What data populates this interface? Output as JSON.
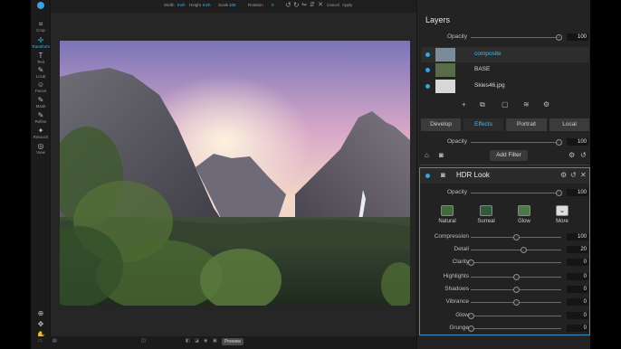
{
  "colors": {
    "accent": "#4fb7e8",
    "panel": "#232323",
    "frame": "#3d8fc4"
  },
  "tools": [
    {
      "icon": "crop-icon",
      "label": "Crop"
    },
    {
      "icon": "transform-icon",
      "label": "Transform"
    },
    {
      "icon": "text-icon",
      "label": "Text"
    },
    {
      "icon": "local-icon",
      "label": "Local"
    },
    {
      "icon": "faces-icon",
      "label": "Faces"
    },
    {
      "icon": "mask-icon",
      "label": "Mask"
    },
    {
      "icon": "refine-icon",
      "label": "Refine"
    },
    {
      "icon": "retouch-icon",
      "label": "Retouch"
    },
    {
      "icon": "view-icon",
      "label": "View"
    }
  ],
  "topbar": {
    "width_label": "Width",
    "width_value": "Inch",
    "height_label": "Height",
    "height_value": "Inch",
    "scale_label": "Scale",
    "scale_value": "100",
    "rotation_label": "Rotation",
    "rotation_value": "0",
    "cancel_label": "Cancel",
    "apply_label": "Apply"
  },
  "bottombar": {
    "preview_label": "Preview"
  },
  "layers": {
    "title": "Layers",
    "opacity_label": "Opacity",
    "opacity_value": "100",
    "items": [
      {
        "name": "composite",
        "active": true
      },
      {
        "name": "BASE",
        "active": false
      },
      {
        "name": "Skies46.jpg",
        "active": false
      }
    ]
  },
  "tabs": [
    {
      "label": "Develop",
      "active": false
    },
    {
      "label": "Effects",
      "active": true
    },
    {
      "label": "Portrait",
      "active": false
    },
    {
      "label": "Local",
      "active": false
    }
  ],
  "effects": {
    "opacity_label": "Opacity",
    "opacity_value": "100",
    "add_filter_label": "Add Filter"
  },
  "filter": {
    "title": "HDR Look",
    "opacity_label": "Opacity",
    "opacity_value": "100",
    "presets": [
      "Natural",
      "Surreal",
      "Glow",
      "More"
    ],
    "sliders": [
      {
        "label": "Compression",
        "value": "100",
        "level": 0.5
      },
      {
        "label": "Detail",
        "value": "20",
        "level": 0.58
      },
      {
        "label": "Clarity",
        "value": "0",
        "level": 0.0
      },
      {
        "label": "Highlights",
        "value": "0",
        "level": 0.5
      },
      {
        "label": "Shadows",
        "value": "0",
        "level": 0.5
      },
      {
        "label": "Vibrance",
        "value": "0",
        "level": 0.5
      },
      {
        "label": "Glow",
        "value": "0",
        "level": 0.0
      },
      {
        "label": "Grunge",
        "value": "0",
        "level": 0.0
      }
    ]
  }
}
